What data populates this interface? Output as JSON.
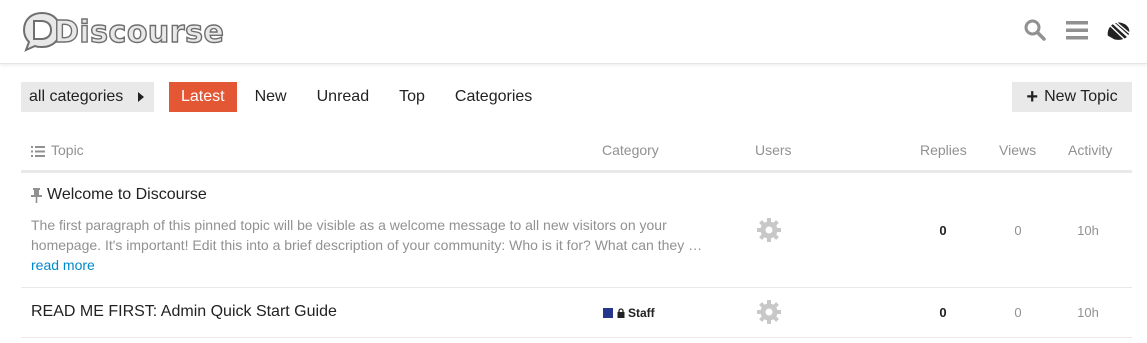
{
  "header": {
    "logo_text": "Discourse",
    "icons": [
      "search-icon",
      "hamburger-menu-icon",
      "user-avatar"
    ]
  },
  "nav": {
    "category_dropdown": "all categories",
    "pills": [
      "Latest",
      "New",
      "Unread",
      "Top",
      "Categories"
    ],
    "active_pill": "Latest",
    "new_topic_label": "New Topic",
    "accent_color": "#e45735"
  },
  "table": {
    "columns": {
      "topic": "Topic",
      "category": "Category",
      "users": "Users",
      "replies": "Replies",
      "views": "Views",
      "activity": "Activity"
    },
    "rows": [
      {
        "title": "Welcome to Discourse",
        "pinned": true,
        "excerpt": "The first paragraph of this pinned topic will be visible as a welcome message to all new visitors on your homepage. It's important! Edit this into a brief description of your community: Who is it for? What can they …",
        "read_more": "read more",
        "category": "",
        "replies": "0",
        "views": "0",
        "activity": "10h"
      },
      {
        "title": "READ ME FIRST: Admin Quick Start Guide",
        "pinned": false,
        "category": "Staff",
        "category_color": "#25368b",
        "category_locked": true,
        "replies": "0",
        "views": "0",
        "activity": "10h"
      }
    ]
  }
}
